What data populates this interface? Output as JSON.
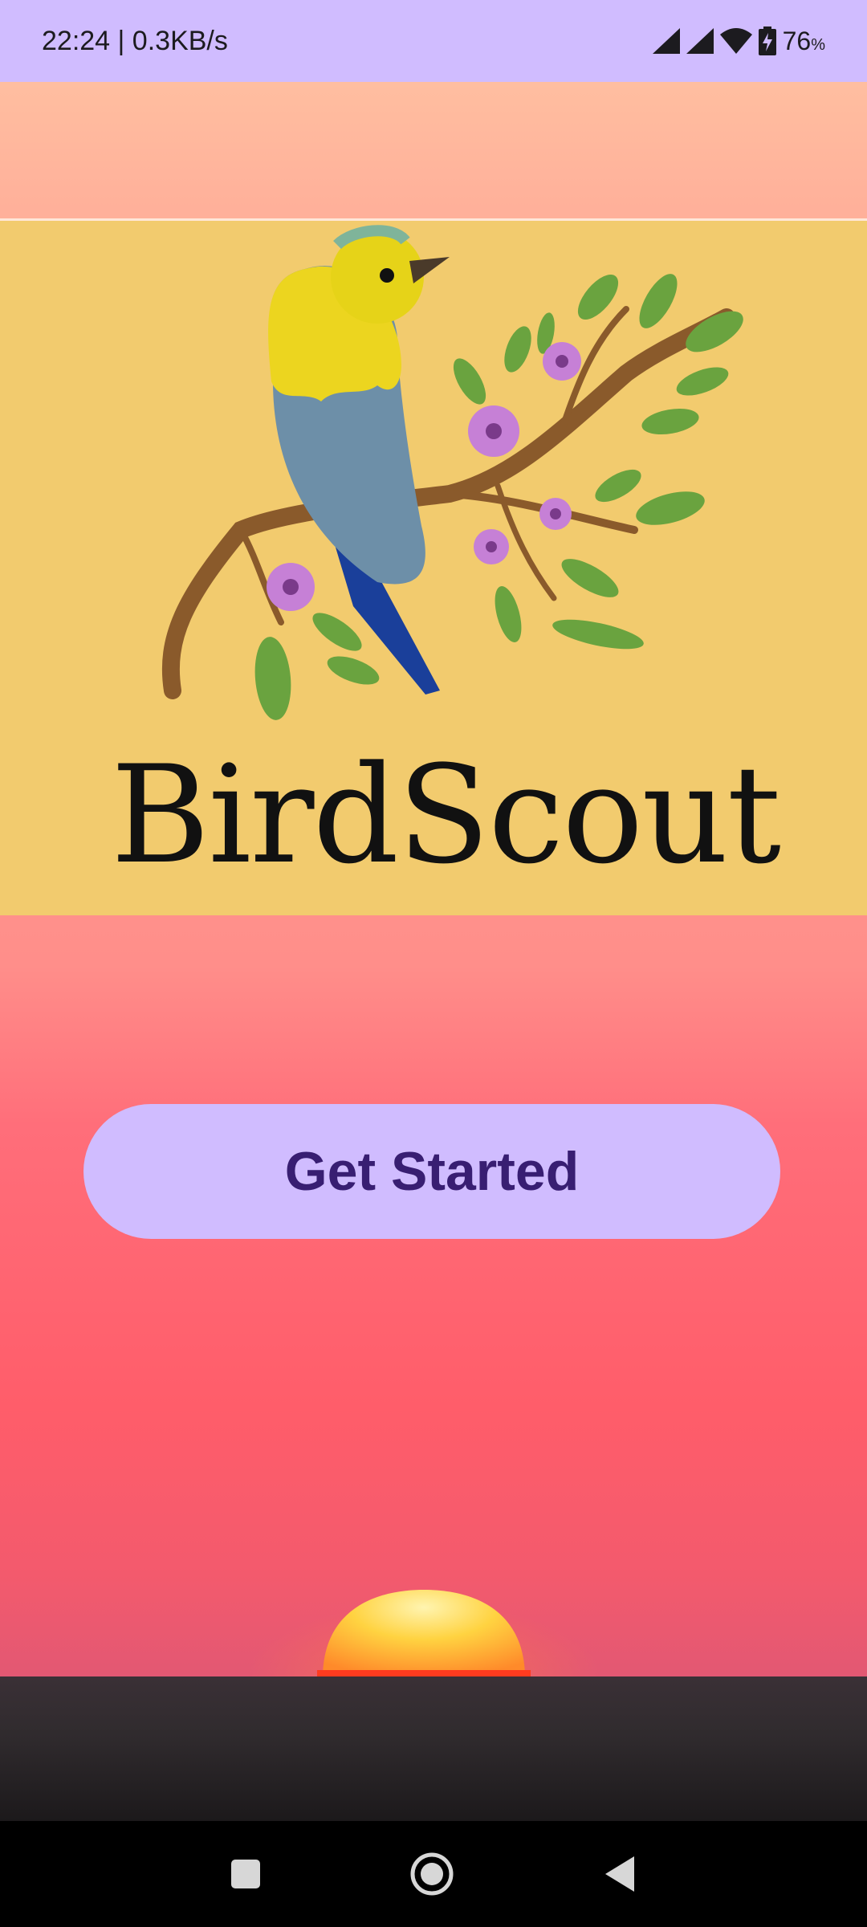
{
  "status_bar": {
    "time_speed": "22:24 | 0.3KB/s",
    "battery_level": "76",
    "battery_unit": "%",
    "icons": [
      "signal-icon",
      "signal-icon",
      "wifi-icon",
      "battery-charging-icon"
    ]
  },
  "logo": {
    "brand_name": "BirdScout"
  },
  "cta": {
    "label": "Get Started"
  },
  "nav_bar": {
    "icons": [
      "recents-icon",
      "home-icon",
      "back-icon"
    ]
  },
  "colors": {
    "status_bar_bg": "#d0bcff",
    "button_bg": "#d0bcff",
    "button_text": "#381e72",
    "logo_bg": "#f2cb6e"
  }
}
